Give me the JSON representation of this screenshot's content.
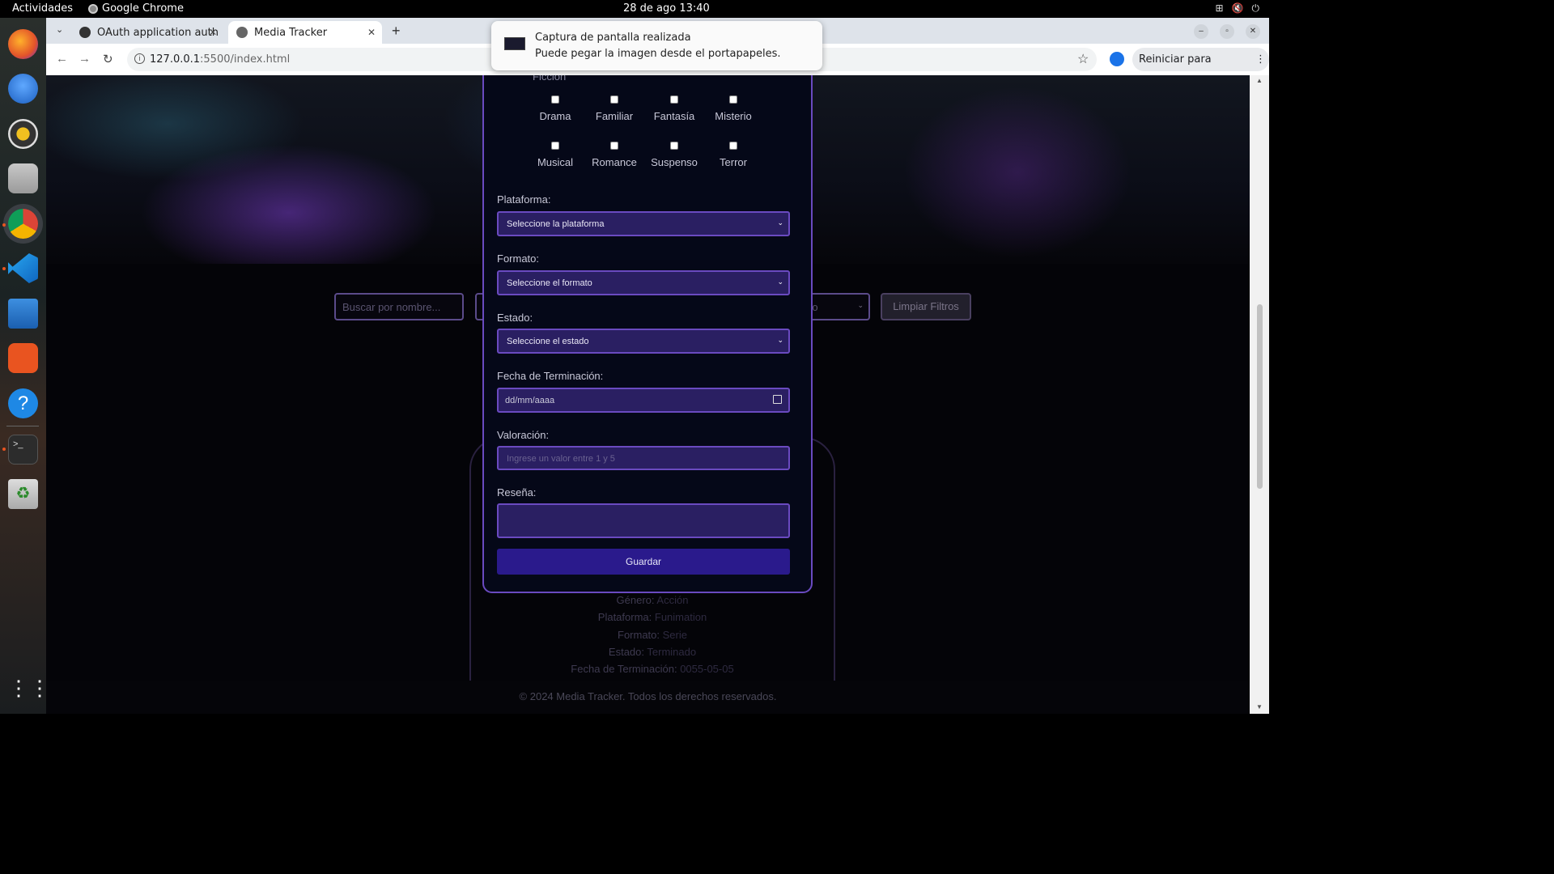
{
  "os": {
    "activities": "Actividades",
    "app_name": "Google Chrome",
    "clock": "28 de ago  13:40"
  },
  "browser": {
    "tabs": [
      {
        "label": "OAuth application auth"
      },
      {
        "label": "Media Tracker"
      }
    ],
    "url_host": "127.0.0.1",
    "url_rest": ":5500/index.html",
    "update_label": "Reiniciar para actualizar"
  },
  "notification": {
    "title": "Captura de pantalla realizada",
    "body": "Puede pegar la imagen desde el portapapeles."
  },
  "page": {
    "filters": {
      "search_placeholder": "Buscar por nombre...",
      "genre_partial": "ro",
      "clear_label": "Limpiar Filtros"
    },
    "card": {
      "genero_label": "Género:",
      "genero_value": "Acción",
      "plataforma_label": "Plataforma:",
      "plataforma_value": "Funimation",
      "formato_label": "Formato:",
      "formato_value": "Serie",
      "estado_label": "Estado:",
      "estado_value": "Terminado",
      "fecha_label": "Fecha de Terminación:",
      "fecha_value": "0055-05-05"
    },
    "footer": "© 2024 Media Tracker. Todos los derechos reservados."
  },
  "modal": {
    "genre_partial": "Ficción",
    "genres_row1": [
      "Drama",
      "Familiar",
      "Fantasía",
      "Misterio"
    ],
    "genres_row2": [
      "Musical",
      "Romance",
      "Suspenso",
      "Terror"
    ],
    "plataforma_label": "Plataforma:",
    "plataforma_value": "Seleccione la plataforma",
    "formato_label": "Formato:",
    "formato_value": "Seleccione el formato",
    "estado_label": "Estado:",
    "estado_value": "Seleccione el estado",
    "fecha_label": "Fecha de Terminación:",
    "fecha_value": "dd/mm/aaaa",
    "valoracion_label": "Valoración:",
    "valoracion_placeholder": "Ingrese un valor entre 1 y 5",
    "resena_label": "Reseña:",
    "save_label": "Guardar"
  },
  "colors": {
    "accent": "#6a4ac0",
    "field_bg": "#2a1f62",
    "button_bg": "#2a1a8c",
    "modal_bg": "#050818"
  }
}
